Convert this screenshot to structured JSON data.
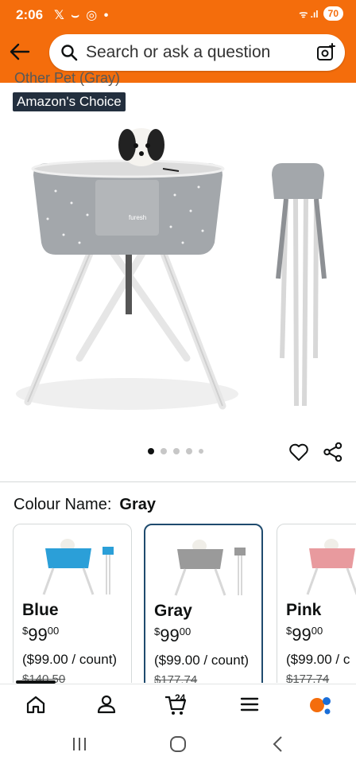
{
  "status_bar": {
    "time": "2:06",
    "notifications": "𝕏 ⌣ ◎ •",
    "signal": "ᯤ .ıl",
    "battery": "70"
  },
  "header": {
    "search_placeholder": "Search or ask a question"
  },
  "product": {
    "title_partial": "Other Pet (Gray)",
    "badge": "Amazon's Choice",
    "image_brand_text": "furesh",
    "image_count": 5,
    "active_image": 1
  },
  "variation": {
    "label": "Colour Name:",
    "selected": "Gray"
  },
  "swatches": [
    {
      "name": "Blue",
      "currency": "$",
      "whole": "99",
      "fraction": "00",
      "per_unit": "($99.00 / count)",
      "was": "$140.50",
      "color": "#2b9fd8"
    },
    {
      "name": "Gray",
      "currency": "$",
      "whole": "99",
      "fraction": "00",
      "per_unit": "($99.00 / count)",
      "was": "$177.74",
      "color": "#9a9a9a"
    },
    {
      "name": "Pink",
      "currency": "$",
      "whole": "99",
      "fraction": "00",
      "per_unit": "($99.00 / c",
      "was": "$177.74",
      "color": "#e89a9e"
    }
  ],
  "bottom_nav": {
    "cart_count": "24"
  },
  "colors": {
    "header": "#f46d0c",
    "badge_bg": "#232f3e",
    "selected_border": "#1f4b6e"
  }
}
